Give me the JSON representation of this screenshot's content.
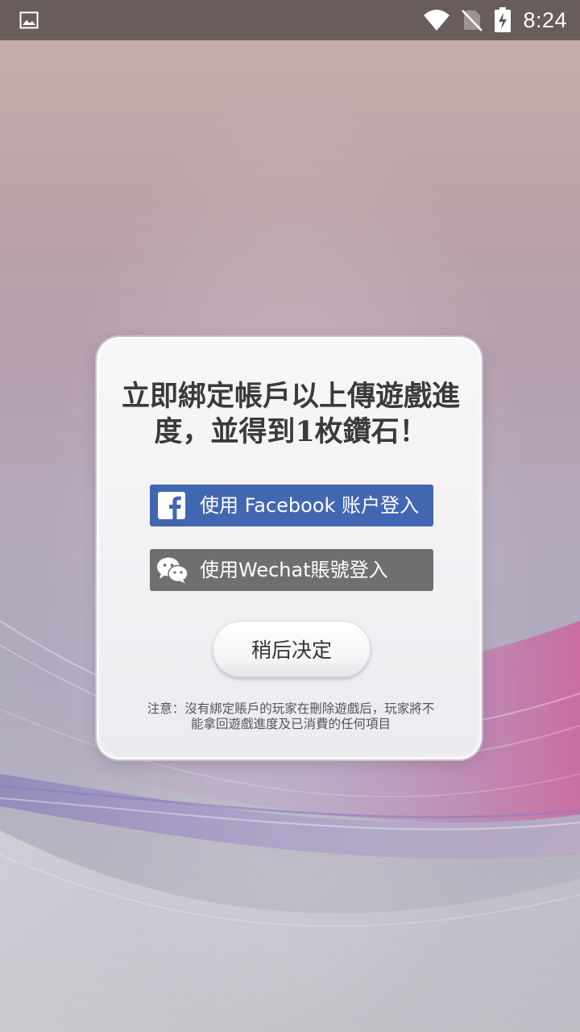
{
  "status_bar": {
    "time": "8:24",
    "icons": [
      "image-notification-icon",
      "wifi-icon",
      "no-sim-icon",
      "battery-charging-icon"
    ]
  },
  "dialog": {
    "title": "立即綁定帳戶以上傳遊戲進度，並得到1枚鑽石！",
    "facebook_button": {
      "label": "使用 Facebook 账户登入",
      "icon": "facebook-icon",
      "color": "#4267b2"
    },
    "wechat_button": {
      "label": "使用Wechat賬號登入",
      "icon": "wechat-icon",
      "color": "#6f6f6f"
    },
    "later_button": {
      "label": "稍后决定"
    },
    "note": "注意：沒有綁定賬戶的玩家在刪除遊戲后，玩家將不能拿回遊戲進度及已消費的任何項目"
  }
}
